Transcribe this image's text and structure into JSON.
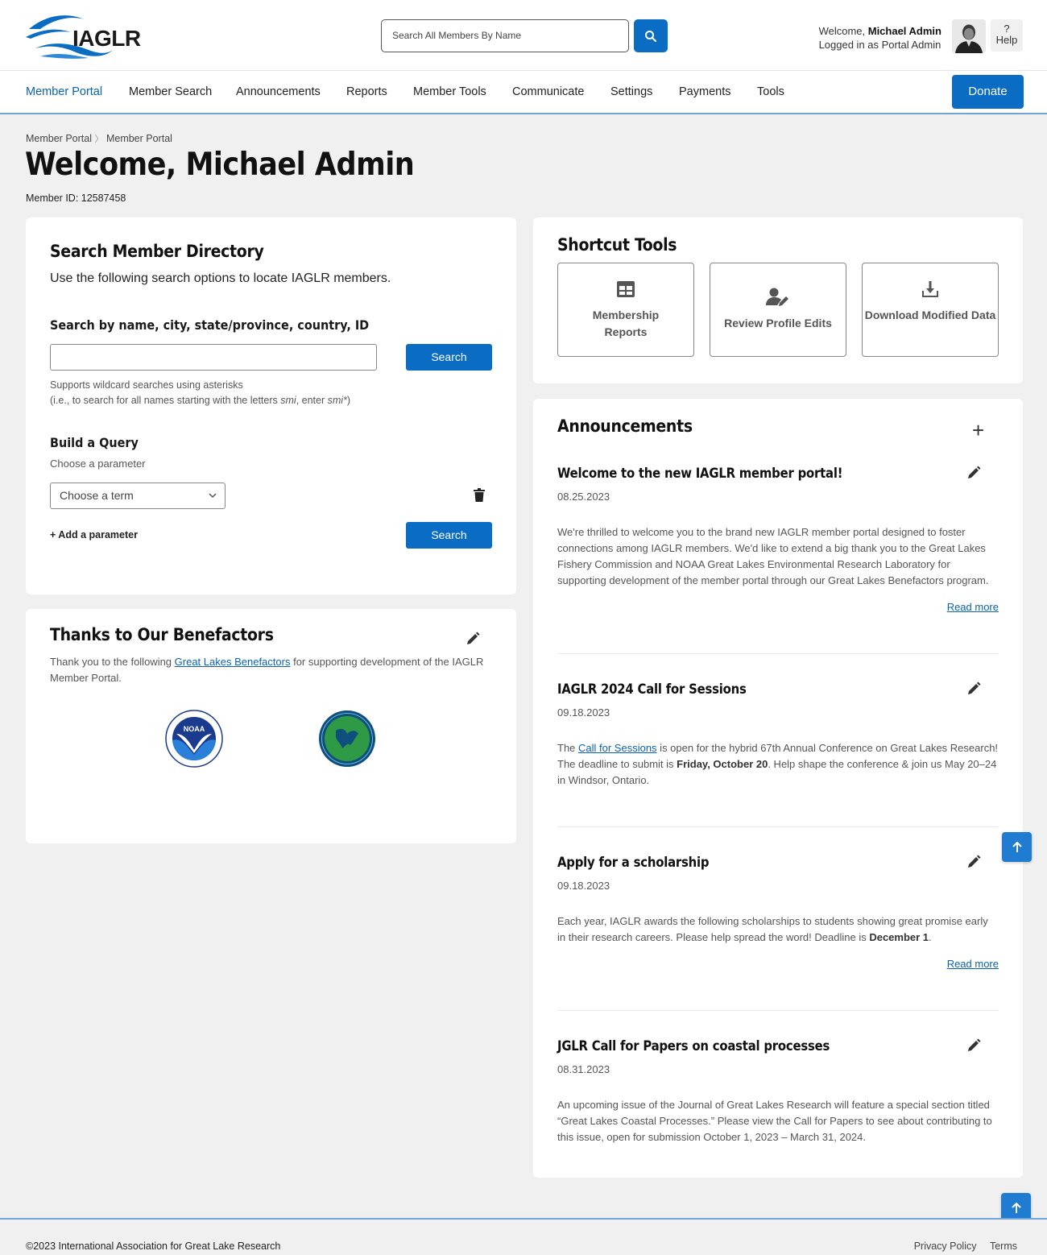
{
  "header": {
    "logo_text": "IAGLR",
    "search_placeholder": "Search All Members By Name",
    "welcome_prefix": "Welcome, ",
    "user_name": "Michael Admin",
    "role_text": "Logged in as Portal Admin",
    "help_glyph": "?",
    "help_label": "Help"
  },
  "nav": {
    "items": [
      "Member Portal",
      "Member Search",
      "Announcements",
      "Reports",
      "Member Tools",
      "Communicate",
      "Settings",
      "Payments",
      "Tools"
    ],
    "active": "Member Portal",
    "donate_label": "Donate"
  },
  "page": {
    "breadcrumb": [
      "Member Portal",
      "Member Portal"
    ],
    "breadcrumb_sep": "〉",
    "title": "Welcome, Michael Admin",
    "member_id": "Member ID: 12587458"
  },
  "search_directory": {
    "title": "Search Member Directory",
    "description": "Use the following search options to locate IAGLR members.",
    "subtitle": "Search by name, city, state/province, country, ID",
    "input_value": "",
    "search_label": "Search",
    "hint_line1": "Supports wildcard searches using asterisks",
    "hint_line2_prefix": "(i.e., to search for all names starting with the letters ",
    "hint_em1": "smi",
    "hint_mid": ", enter ",
    "hint_em2": "smi*",
    "hint_suffix": ")",
    "build_title": "Build a Query",
    "build_sub": "Choose a parameter",
    "select_value": "Choose a term",
    "add_param": "+ Add a parameter",
    "query_search_label": "Search"
  },
  "benefactors": {
    "title": "Thanks to Our Benefactors",
    "text_prefix": "Thank you to the following ",
    "link": "Great Lakes Benefactors",
    "text_suffix": " for supporting development of the IAGLR Member Portal.",
    "noaa_text": "NOAA"
  },
  "shortcuts": {
    "title": "Shortcut Tools",
    "tiles": [
      {
        "label": "Membership Reports",
        "icon": "table-icon"
      },
      {
        "label": "Review Profile Edits",
        "icon": "user-edit-icon"
      },
      {
        "label": "Download Modified Data",
        "icon": "download-icon"
      }
    ]
  },
  "announcements": {
    "title": "Announcements",
    "add_glyph": "+",
    "items": [
      {
        "title": "Welcome to the new IAGLR member portal!",
        "date": "08.25.2023",
        "body": "We're thrilled to welcome you to the brand new IAGLR member portal designed to foster connections among IAGLR members. We'd like to extend a big thank you to the Great Lakes Fishery Commission and NOAA Great Lakes Environmental Research Laboratory for supporting development of the member portal through our Great Lakes Benefactors program.",
        "read_more": "Read more"
      },
      {
        "title": "IAGLR 2024 Call for Sessions",
        "date": "09.18.2023",
        "body_prefix": "The ",
        "body_link": "Call for Sessions",
        "body_mid": " is open for the hybrid 67th Annual Conference on Great Lakes Research! The deadline to submit is ",
        "body_bold": "Friday, October 20",
        "body_suffix": ". Help shape the conference & join us May 20–24 in Windsor, Ontario."
      },
      {
        "title": "Apply for a scholarship",
        "date": "09.18.2023",
        "body_prefix": "Each year, IAGLR awards the following scholarships to students showing great promise early in their research careers. Please help spread the word! Deadline is ",
        "body_bold": "December 1",
        "body_suffix": ".",
        "read_more": "Read more"
      },
      {
        "title": "JGLR Call for Papers on coastal processes",
        "date": "08.31.2023",
        "body": "An upcoming issue of the Journal of Great Lakes Research will feature a special section titled “Great Lakes Coastal Processes.” Please view the Call for Papers to see about contributing to this issue, open for submission October 1, 2023 – March 31, 2024."
      }
    ]
  },
  "footer": {
    "copyright": "©2023  International Association for Great Lake Research",
    "privacy": "Privacy Policy",
    "terms": "Terms"
  },
  "colors": {
    "primary": "#0a6cc2",
    "link": "#0a62b0",
    "nav_border": "#6ea4d6",
    "background": "#f0f0f0"
  }
}
